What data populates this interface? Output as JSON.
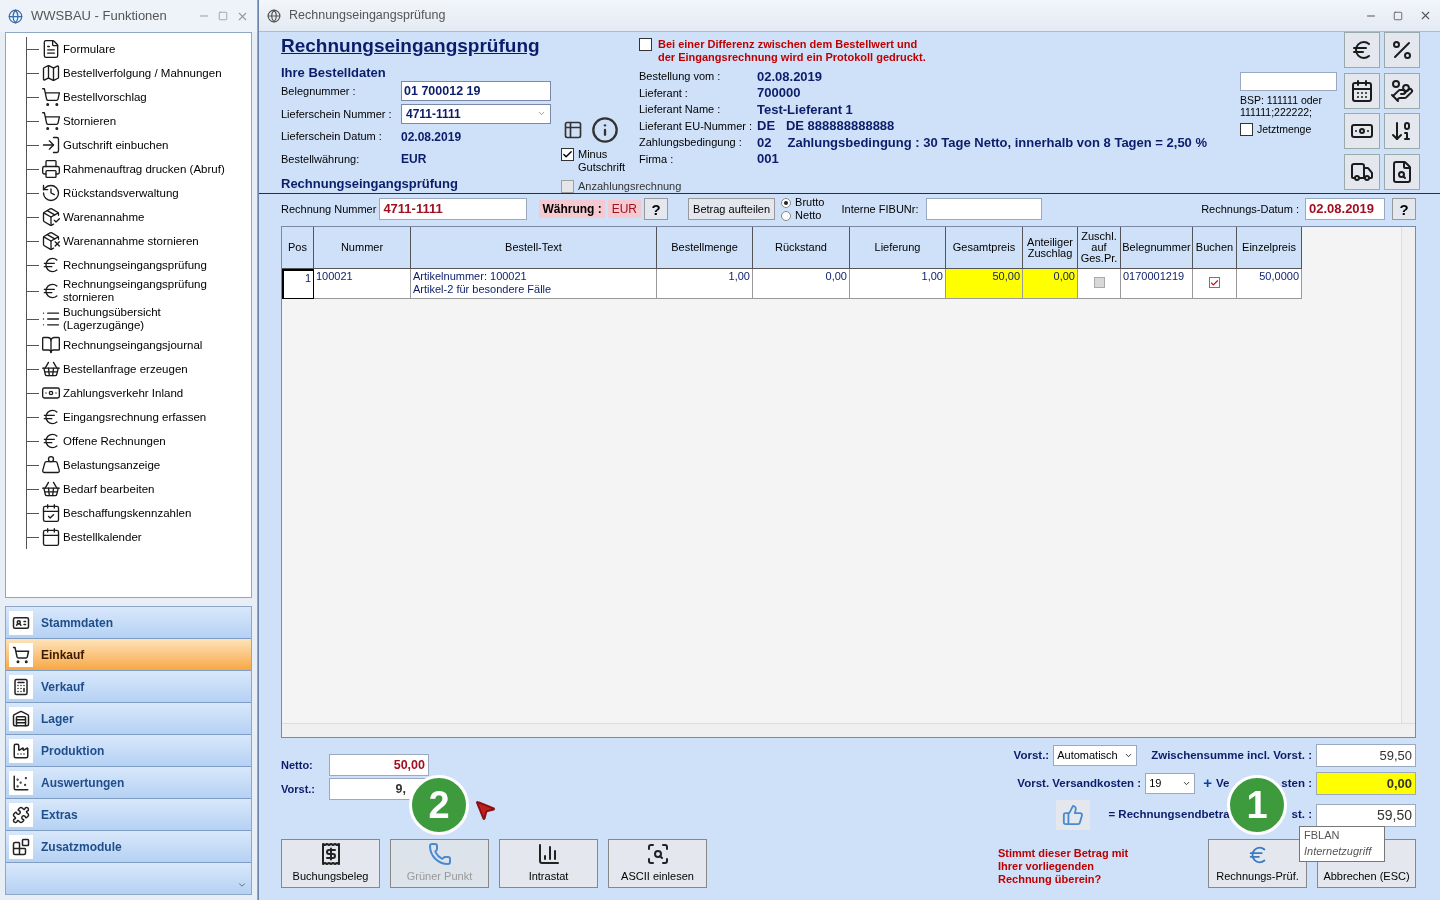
{
  "sidebar": {
    "title": "WWSBAU - Funktionen",
    "items": [
      {
        "label": "Formulare"
      },
      {
        "label": "Bestellverfolgung / Mahnungen"
      },
      {
        "label": "Bestellvorschlag"
      },
      {
        "label": "Stornieren"
      },
      {
        "label": "Gutschrift einbuchen"
      },
      {
        "label": "Rahmenauftrag drucken (Abruf)"
      },
      {
        "label": "Rückstandsverwaltung"
      },
      {
        "label": "Warenannahme"
      },
      {
        "label": "Warenannahme stornieren"
      },
      {
        "label": "Rechnungseingangsprüfung"
      },
      {
        "label": "Rechnungseingangsprüfung stornieren"
      },
      {
        "label": "Buchungsübersicht (Lagerzugänge)"
      },
      {
        "label": "Rechnungseingangsjournal"
      },
      {
        "label": "Bestellanfrage erzeugen"
      },
      {
        "label": "Zahlungsverkehr Inland"
      },
      {
        "label": "Eingangsrechnung erfassen"
      },
      {
        "label": "Offene Rechnungen"
      },
      {
        "label": "Belastungsanzeige"
      },
      {
        "label": "Bedarf bearbeiten"
      },
      {
        "label": "Beschaffungskennzahlen"
      },
      {
        "label": "Bestellkalender"
      }
    ],
    "modules": [
      {
        "label": "Stammdaten",
        "selected": false
      },
      {
        "label": "Einkauf",
        "selected": true
      },
      {
        "label": "Verkauf",
        "selected": false
      },
      {
        "label": "Lager",
        "selected": false
      },
      {
        "label": "Produktion",
        "selected": false
      },
      {
        "label": "Auswertungen",
        "selected": false
      },
      {
        "label": "Extras",
        "selected": false
      },
      {
        "label": "Zusatzmodule",
        "selected": false
      }
    ]
  },
  "window": {
    "title": "Rechnungseingangsprüfung"
  },
  "heading": "Rechnungseingangsprüfung",
  "order_section": {
    "title": "Ihre Bestelldaten",
    "fields": [
      {
        "kind": "input",
        "label": "Belegnummer :",
        "value": "01 700012 19"
      },
      {
        "kind": "select",
        "label": "Lieferschein Nummer :",
        "value": "4711-1111"
      },
      {
        "kind": "text",
        "label": "Lieferschein Datum :",
        "value": "02.08.2019"
      },
      {
        "kind": "text",
        "label": "Bestellwährung:",
        "value": "EUR"
      }
    ]
  },
  "subheading": "Rechnungseingangsprüfung",
  "minus_gutschrift": {
    "label": "Minus Gutschrift",
    "checked": true
  },
  "anzahlungsrechnung": {
    "label": "Anzahlungsrechnung",
    "checked": false,
    "disabled": true
  },
  "protocol": {
    "label": "Bei einer Differenz zwischen dem Bestellwert und der Eingangsrechnung wird ein Protokoll gedruckt.",
    "checked": false
  },
  "order_info": [
    {
      "label": "Bestellung vom :",
      "value": "02.08.2019"
    },
    {
      "label": "Lieferant :",
      "value": "700000"
    },
    {
      "label": "Lieferant Name :",
      "value": "Test-Lieferant 1"
    },
    {
      "label": "Lieferant EU-Nummer :",
      "value": "DE   DE 888888888888"
    },
    {
      "label": "Zahlungsbedingung :",
      "value": "02",
      "detail": "Zahlungsbedingung : 30 Tage Netto, innerhalb von 8 Tagen = 2,50 %"
    },
    {
      "label": "Firma :",
      "value": "001"
    }
  ],
  "filter": {
    "note": "BSP: 111111 oder 111111;222222;",
    "jetztmenge": {
      "label": "Jetztmenge",
      "checked": false
    }
  },
  "invoice_bar": {
    "number_label": "Rechnung Nummer",
    "number": "4711-1111",
    "currency_label": "Währung :",
    "currency": "EUR",
    "help": "?",
    "split_button": "Betrag aufteilen",
    "modes": [
      {
        "label": "Brutto",
        "selected": true
      },
      {
        "label": "Netto",
        "selected": false
      }
    ],
    "fibu_label": "Interne FIBUNr:",
    "date_label": "Rechnungs-Datum :",
    "date": "02.08.2019",
    "date_help": "?"
  },
  "table": {
    "columns": [
      "Pos",
      "Nummer",
      "Bestell-Text",
      "Bestellmenge",
      "Rückstand",
      "Lieferung",
      "Gesamtpreis",
      "Anteiliger Zuschlag",
      "Zuschl. auf Ges.Pr.",
      "Belegnummer",
      "Buchen",
      "Einzelpreis"
    ],
    "rows": [
      {
        "cells": [
          {
            "kind": "text",
            "text": "1",
            "highlighted": false
          },
          {
            "kind": "text",
            "text": "100021",
            "highlighted": false
          },
          {
            "kind": "lines",
            "lines": [
              "Artikelnummer: 100021",
              "Artikel-2 für besondere Fälle"
            ],
            "highlighted": false
          },
          {
            "kind": "text",
            "text": "1,00",
            "highlighted": false
          },
          {
            "kind": "text",
            "text": "0,00",
            "highlighted": false
          },
          {
            "kind": "text",
            "text": "1,00",
            "highlighted": false
          },
          {
            "kind": "text",
            "text": "50,00",
            "highlighted": true
          },
          {
            "kind": "text",
            "text": "0,00",
            "highlighted": true
          },
          {
            "kind": "check",
            "checked": false,
            "disabled": true
          },
          {
            "kind": "text",
            "text": "0170001219",
            "highlighted": false
          },
          {
            "kind": "check",
            "checked": true,
            "disabled": false
          },
          {
            "kind": "text",
            "text": "50,0000",
            "highlighted": false
          }
        ]
      }
    ]
  },
  "totals_left": [
    {
      "label": "Netto:",
      "value": "50,00"
    },
    {
      "label": "Vorst.:",
      "value": "9,"
    }
  ],
  "totals_right": {
    "vorst_label": "Vorst.:",
    "vorst_select": "Automatisch",
    "subtotal_label": "Zwischensumme incl. Vorst. :",
    "subtotal": "59,50",
    "shipping_vat_label": "Vorst. Versandkosten :",
    "shipping_vat": "19",
    "plus": "+",
    "shipping_label_start": "Ve",
    "shipping_label_end": "sten :",
    "shipping": "0,00",
    "total_label_start": "= Rechnungsendbetra",
    "total_label_end": "st. :",
    "total": "59,50"
  },
  "buttons": [
    {
      "label": "Buchungsbeleg",
      "disabled": false
    },
    {
      "label": "Grüner Punkt",
      "disabled": true
    },
    {
      "label": "Intrastat",
      "disabled": false
    },
    {
      "label": "ASCII einlesen",
      "disabled": false
    }
  ],
  "question": "Stimmt dieser Betrag mit Ihrer vorliegenden Rechnung überein?",
  "action_buttons": [
    {
      "label": "Rechnungs-Prüf."
    },
    {
      "label": "Abbrechen (ESC)"
    }
  ],
  "tooltip": {
    "title": "FBLAN",
    "subtitle": "Internetzugriff"
  },
  "markers": [
    {
      "label": "2"
    },
    {
      "label": "1"
    }
  ]
}
